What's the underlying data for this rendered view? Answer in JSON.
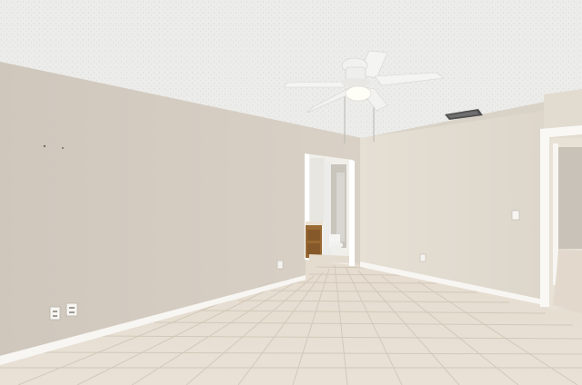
{
  "scene": {
    "kind": "photo",
    "colors": {
      "ceiling": "#ebebe9",
      "wall_left": "#d6cfc5",
      "wall_right": "#e3dcd0",
      "floor": "#e6ddd1",
      "baseboard": "#f7f5f2",
      "grout": "#d0c6b8",
      "vanity": "#9a6a34",
      "fan_white": "#f4f4f2"
    },
    "objects": [
      "textured-ceiling",
      "ceiling-fan-with-light",
      "ac-vent",
      "left-wall",
      "back-wall",
      "right-wall",
      "tile-floor",
      "baseboards",
      "bathroom-doorway",
      "bathroom-vanity",
      "toilet",
      "hallway-doorway",
      "electrical-outlets",
      "light-switch"
    ]
  }
}
